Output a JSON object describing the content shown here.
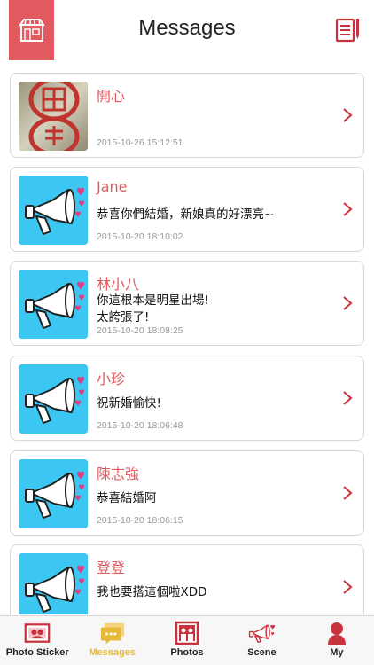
{
  "header": {
    "title": "Messages",
    "accent": "#e25a5f"
  },
  "messages": [
    {
      "name": "開心",
      "text": "",
      "time": "2015-10-26 15:12:51",
      "avatar": "stamp-photo"
    },
    {
      "name": "Jane",
      "text": "恭喜你們結婚，新娘真的好漂亮~",
      "time": "2015-10-20 18:10:02",
      "avatar": "megaphone-icon"
    },
    {
      "name": "林小八",
      "text": "你這根本是明星出場!\n太誇張了!",
      "time": "2015-10-20 18:08:25",
      "avatar": "megaphone-icon"
    },
    {
      "name": "小珍",
      "text": "祝新婚愉快!",
      "time": "2015-10-20 18:06:48",
      "avatar": "megaphone-icon"
    },
    {
      "name": "陳志強",
      "text": "恭喜結婚阿",
      "time": "2015-10-20 18:06:15",
      "avatar": "megaphone-icon"
    },
    {
      "name": "登登",
      "text": "我也要搭這個啦XDD",
      "time": "",
      "avatar": "megaphone-icon"
    }
  ],
  "tabs": [
    {
      "label": "Photo Sticker",
      "icon": "photo-sticker-icon",
      "active": false
    },
    {
      "label": "Messages",
      "icon": "messages-icon",
      "active": true
    },
    {
      "label": "Photos",
      "icon": "photos-icon",
      "active": false
    },
    {
      "label": "Scene",
      "icon": "scene-icon",
      "active": false
    },
    {
      "label": "My",
      "icon": "person-icon",
      "active": false
    }
  ]
}
